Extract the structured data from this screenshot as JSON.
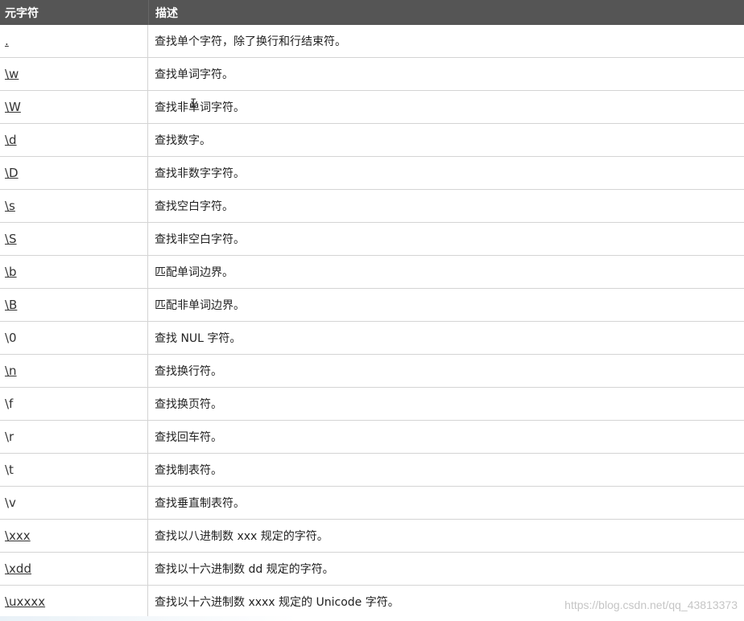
{
  "header": {
    "col_metachar": "元字符",
    "col_description": "描述"
  },
  "rows": [
    {
      "meta": ".",
      "desc": "查找单个字符，除了换行和行结束符。",
      "link": true
    },
    {
      "meta": "\\w",
      "desc": "查找单词字符。",
      "link": true
    },
    {
      "meta": "\\W",
      "desc": "查找非单词字符。",
      "link": true
    },
    {
      "meta": "\\d",
      "desc": "查找数字。",
      "link": true
    },
    {
      "meta": "\\D",
      "desc": "查找非数字字符。",
      "link": true
    },
    {
      "meta": "\\s",
      "desc": "查找空白字符。",
      "link": true
    },
    {
      "meta": "\\S",
      "desc": "查找非空白字符。",
      "link": true
    },
    {
      "meta": "\\b",
      "desc": "匹配单词边界。",
      "link": true
    },
    {
      "meta": "\\B",
      "desc": "匹配非单词边界。",
      "link": true
    },
    {
      "meta": "\\0",
      "desc": "查找 NUL 字符。",
      "link": false
    },
    {
      "meta": "\\n",
      "desc": "查找换行符。",
      "link": true
    },
    {
      "meta": "\\f",
      "desc": "查找换页符。",
      "link": false
    },
    {
      "meta": "\\r",
      "desc": "查找回车符。",
      "link": false
    },
    {
      "meta": "\\t",
      "desc": "查找制表符。",
      "link": false
    },
    {
      "meta": "\\v",
      "desc": "查找垂直制表符。",
      "link": false
    },
    {
      "meta": "\\xxx",
      "desc": "查找以八进制数 xxx 规定的字符。",
      "link": true
    },
    {
      "meta": "\\xdd",
      "desc": "查找以十六进制数 dd 规定的字符。",
      "link": true
    },
    {
      "meta": "\\uxxxx",
      "desc": "查找以十六进制数 xxxx 规定的 Unicode 字符。",
      "link": true
    }
  ],
  "watermark": "https://blog.csdn.net/qq_43813373"
}
